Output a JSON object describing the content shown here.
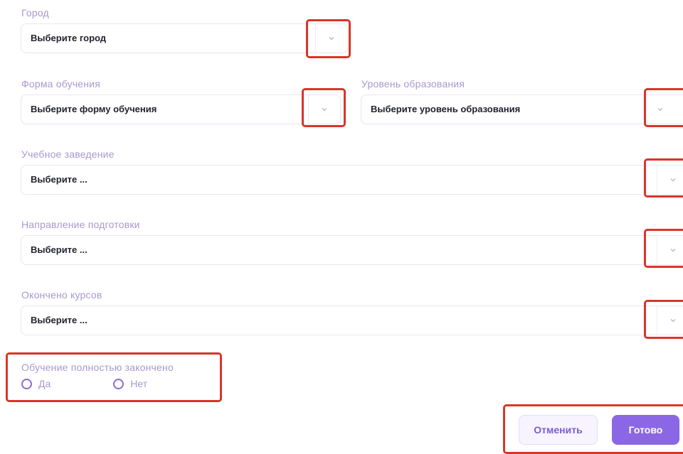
{
  "fields": {
    "city": {
      "label": "Город",
      "value": "Выберите город"
    },
    "study_form": {
      "label": "Форма обучения",
      "value": "Выберите форму обучения"
    },
    "education_level": {
      "label": "Уровень образования",
      "value": "Выберите уровень образования"
    },
    "institution": {
      "label": "Учебное заведение",
      "value": "Выберите ..."
    },
    "specialty": {
      "label": "Направление подготовки",
      "value": "Выберите ..."
    },
    "courses_completed": {
      "label": "Окончено курсов",
      "value": "Выберите ..."
    }
  },
  "completed": {
    "label": "Обучение полностью закончено",
    "options": [
      "Да",
      "Нет"
    ]
  },
  "buttons": {
    "cancel": "Отменить",
    "done": "Готово"
  },
  "colors": {
    "label": "#a898cf",
    "accent": "#8b67e6",
    "highlight": "#d9352a",
    "text": "#222230"
  },
  "icons": {
    "dropdown": "chevron-down-icon",
    "radio": "radio-empty-icon"
  }
}
